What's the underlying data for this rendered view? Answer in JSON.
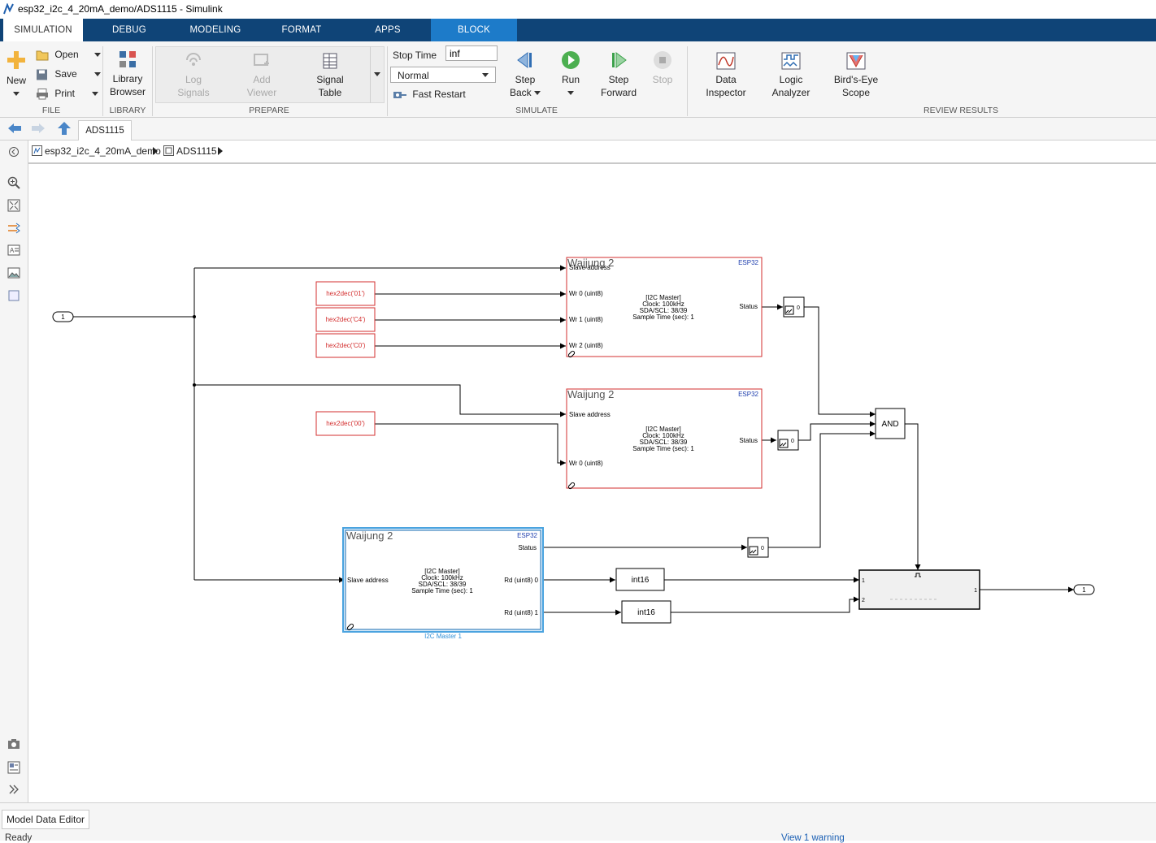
{
  "window": {
    "title": "esp32_i2c_4_20mA_demo/ADS1115 - Simulink"
  },
  "tabs": [
    "SIMULATION",
    "DEBUG",
    "MODELING",
    "FORMAT",
    "APPS",
    "BLOCK"
  ],
  "ribbon": {
    "file": {
      "label": "FILE",
      "new": "New",
      "open": "Open",
      "save": "Save",
      "print": "Print"
    },
    "library": {
      "label": "LIBRARY",
      "browser_line1": "Library",
      "browser_line2": "Browser"
    },
    "prepare": {
      "label": "PREPARE",
      "log_signals_1": "Log",
      "log_signals_2": "Signals",
      "add_viewer_1": "Add",
      "add_viewer_2": "Viewer",
      "signal_table_1": "Signal",
      "signal_table_2": "Table"
    },
    "simulate": {
      "label": "SIMULATE",
      "stop_time_label": "Stop Time",
      "stop_time_value": "inf",
      "mode": "Normal",
      "fast_restart": "Fast Restart",
      "step_back_1": "Step",
      "step_back_2": "Back",
      "run": "Run",
      "step_forward_1": "Step",
      "step_forward_2": "Forward",
      "stop": "Stop"
    },
    "review": {
      "label": "REVIEW RESULTS",
      "data_inspector_1": "Data",
      "data_inspector_2": "Inspector",
      "logic_analyzer_1": "Logic",
      "logic_analyzer_2": "Analyzer",
      "birds_eye_1": "Bird's-Eye",
      "birds_eye_2": "Scope"
    }
  },
  "nav": {
    "model_tab": "ADS1115"
  },
  "breadcrumb": {
    "root": "esp32_i2c_4_20mA_demo",
    "child": "ADS1115"
  },
  "diagram": {
    "inport": "1",
    "outport": "1",
    "constants": [
      "hex2dec('01')",
      "hex2dec('C4')",
      "hex2dec('C0')",
      "hex2dec('00')"
    ],
    "waijung": "Waijung 2",
    "esp32": "ESP32",
    "block_info": [
      "[I2C Master]",
      "Clock: 100kHz",
      "SDA/SCL: 38/39",
      "Sample Time (sec): 1"
    ],
    "ports": {
      "slave_address": "Slave address",
      "wr0": "Wr 0 (uint8)",
      "wr1": "Wr 1 (uint8)",
      "wr2": "Wr 2 (uint8)",
      "status": "Status",
      "rd0": "Rd (uint8) 0",
      "rd1": "Rd (uint8) 1"
    },
    "display_value": "0",
    "and_label": "AND",
    "convert_label": "int16",
    "selected_block_name": "I2C Master 1",
    "subsystem_in1": "1",
    "subsystem_in2": "2",
    "subsystem_out1": "1"
  },
  "bottom": {
    "model_data_editor": "Model Data Editor",
    "status": "Ready",
    "warning": "View 1 warning"
  }
}
